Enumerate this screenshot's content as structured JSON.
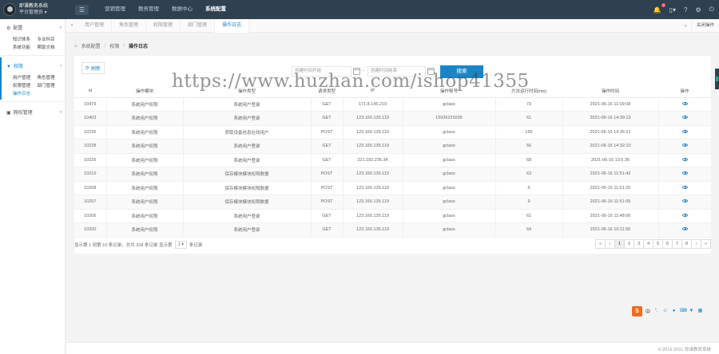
{
  "app": {
    "title": "即课教务系统",
    "user_label": "平台管理员 ▾"
  },
  "topnav": {
    "menu_icon": "hamburger-icon",
    "items": [
      "营销管理",
      "教务管理",
      "数据中心",
      "系统配置"
    ],
    "active_index": 3
  },
  "top_icons": {
    "notification_count": "9",
    "icons": [
      "bell-icon",
      "phone-icon",
      "help-icon",
      "settings-icon",
      "power-icon"
    ]
  },
  "sidebar": {
    "sections": [
      {
        "title": "配置",
        "icon": "gear-icon",
        "items": [
          "知识体系",
          "专业科目",
          "系统功能",
          "帮助文档"
        ]
      },
      {
        "title": "权限",
        "icon": "filter-icon",
        "items": [
          "用户管理",
          "角色管理",
          "权限管理",
          "部门管理",
          "操作日志"
        ],
        "active_item": "操作日志"
      },
      {
        "title": "网校管理",
        "icon": "school-icon",
        "items": []
      }
    ]
  },
  "tabs": {
    "items": [
      "用户管理",
      "角色管理",
      "权限管理",
      "部门管理",
      "操作日志"
    ],
    "active_index": 4,
    "close_label": "关闭操作"
  },
  "breadcrumb": {
    "items": [
      "系统配置",
      "权限",
      "操作日志"
    ],
    "home_icon": "home-icon"
  },
  "toolbar": {
    "refresh_label": "刷新",
    "start_placeholder": "创建时间开始",
    "end_placeholder": "创建时间结束",
    "separator": "-",
    "search_label": "搜索"
  },
  "table": {
    "columns": [
      "id",
      "操作模块",
      "操作类型",
      "请求类型",
      "IP",
      "操作账号",
      "方法运行时间(ms)",
      "操作时间",
      "操作"
    ],
    "rows": [
      [
        "10479",
        "系统用户权限",
        "系统用户登录",
        "GET",
        "171.8.145.219",
        "gclass",
        "73",
        "2021-06-16 11:09:08"
      ],
      [
        "10403",
        "系统用户权限",
        "系统用户登录",
        "GET",
        "123.160.135.119",
        "15936229295",
        "61",
        "2021-06-16 14:39:19"
      ],
      [
        "10236",
        "系统用户权限",
        "获取设备信息在线用户",
        "POST",
        "123.160.135.119",
        "gclass",
        "155",
        "2021-06-16 14:36:21"
      ],
      [
        "10228",
        "系统用户权限",
        "系统用户登录",
        "GET",
        "123.160.135.119",
        "gclass",
        "56",
        "2021-06-16 14:32:10"
      ],
      [
        "10226",
        "系统用户权限",
        "系统用户登录",
        "GET",
        "221.182.236.34",
        "gclass",
        "68",
        "2021-06-16 13:5:36"
      ],
      [
        "10210",
        "系统用户权限",
        "保存模块模块权限数据",
        "POST",
        "123.160.135.119",
        "gclass",
        "63",
        "2021-06-16 11:51:42"
      ],
      [
        "10208",
        "系统用户权限",
        "保存模块模块权限数据",
        "POST",
        "123.160.135.119",
        "gclass",
        "6",
        "2021-06-16 11:51:25"
      ],
      [
        "10207",
        "系统用户权限",
        "保存模块模块权限数据",
        "POST",
        "123.160.135.119",
        "gclass",
        "9",
        "2021-06-16 11:51:05"
      ],
      [
        "10206",
        "系统用户权限",
        "系统用户登录",
        "GET",
        "123.160.135.119",
        "gclass",
        "61",
        "2021-06-16 11:48:06"
      ],
      [
        "10200",
        "系统用户权限",
        "系统用户登录",
        "GET",
        "123.160.135.119",
        "gclass",
        "64",
        "2021-06-16 10:11:55"
      ]
    ],
    "action_icon": "eye-icon"
  },
  "pagination": {
    "info_before": "显示第 1 到第 10 条记录，总共 318 条记录 显示第",
    "page_size": "1",
    "info_after": "条记录",
    "pages": [
      "«",
      "‹",
      "1",
      "2",
      "3",
      "4",
      "5",
      "6",
      "7",
      "8",
      "›",
      "»"
    ],
    "active_page": "1"
  },
  "footer": {
    "copyright": "© 2016-2021 即课教育系统"
  },
  "ime": {
    "logo": "S",
    "lang": "中",
    "icons": [
      "punctuation-icon",
      "emoji-icon",
      "mic-icon",
      "keyboard-icon",
      "shirt-icon",
      "menu-icon"
    ]
  },
  "watermark": "https://www.huzhan.com/ishop41355"
}
